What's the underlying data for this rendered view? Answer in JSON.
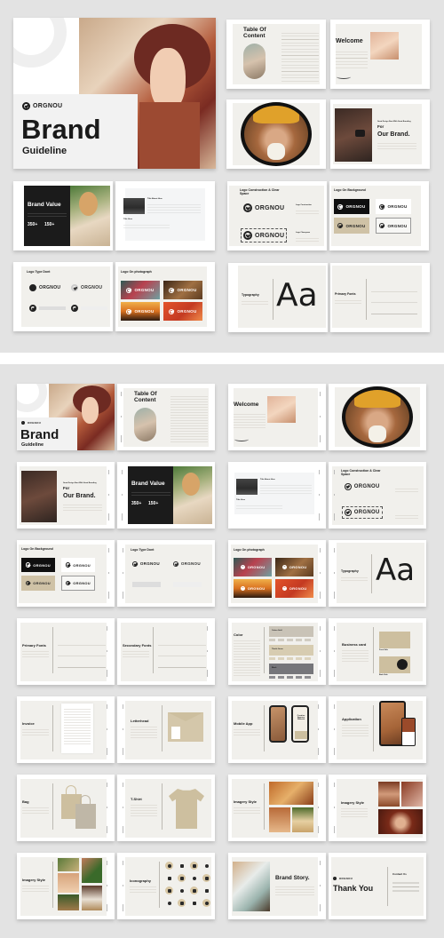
{
  "brand": {
    "name": "ORGNOU",
    "accent": "#cbbd9f",
    "dark": "#1b1b1b",
    "paper": "#f1f0ec",
    "canvas": "#e3e3e3"
  },
  "section1": {
    "cover": {
      "logo": "ORGNOU",
      "title": "Brand",
      "subtitle": "Guideline"
    },
    "toc": {
      "title": "Table Of Content"
    },
    "welcome": {
      "title": "Welcome"
    },
    "portrait": {
      "alt": "woman with yellow headband"
    },
    "our_brand": {
      "kicker": "Great Design Start With Great Branding",
      "for": "For",
      "title": "Our Brand."
    },
    "brand_value": {
      "title": "Brand Value",
      "stat1": "350+",
      "stat2": "150+"
    },
    "article": {
      "heading": "Title About Here",
      "subheading": "Title Here"
    },
    "logo_construction": {
      "title": "Logo Construction & Clear Space",
      "label1": "Logo Construction",
      "label2": "Logo Clearspace",
      "logo": "ORGNOU"
    },
    "logo_background": {
      "title": "Logo On Background",
      "logo": "ORGNOU"
    },
    "logo_type_dont": {
      "title": "Logo Type Dont",
      "logo": "ORGNOU"
    },
    "logo_photo": {
      "title": "Logo On photograph",
      "logo": "ORGNOU"
    },
    "typography": {
      "title": "Typography",
      "sample": "Aa"
    },
    "primary_fonts": {
      "title": "Primary Fonts"
    }
  },
  "section2": {
    "cover": {
      "logo": "ORGNOU",
      "title": "Brand",
      "subtitle": "Guideline"
    },
    "toc": {
      "title": "Table Of Content"
    },
    "welcome": {
      "title": "Welcome"
    },
    "our_brand": {
      "kicker": "Great Design Start With Great Branding",
      "for": "For",
      "title": "Our Brand."
    },
    "brand_value": {
      "title": "Brand Value",
      "stat1": "350+",
      "stat2": "150+"
    },
    "article": {
      "heading": "Title About Here",
      "subheading": "Title Here"
    },
    "logo_construction": {
      "title": "Logo Construction & Clear Space",
      "logo": "ORGNOU"
    },
    "logo_background": {
      "title": "Logo On Background",
      "logo": "ORGNOU"
    },
    "logo_type_dont": {
      "title": "Logo Type Dont",
      "logo": "ORGNOU"
    },
    "logo_photo": {
      "title": "Logo On photograph",
      "logo": "ORGNOU"
    },
    "typography": {
      "title": "Typography",
      "sample": "Aa"
    },
    "primary_fonts": {
      "title": "Primary Fonts"
    },
    "secondary_fonts": {
      "title": "Secondary Fonts"
    },
    "color": {
      "title": "Color",
      "swatches": [
        {
          "name": "Cotton Gold",
          "hex": "#c9c3b7"
        },
        {
          "name": "Thistle Green",
          "hex": "#d7ccb1"
        },
        {
          "name": "Black",
          "hex": "#76767a"
        }
      ]
    },
    "business_card": {
      "title": "Business card",
      "front": "Front Side",
      "back": "Back Side"
    },
    "invoice": {
      "title": "Invoice"
    },
    "letterhead": {
      "title": "Letterhead"
    },
    "mobile_app": {
      "title": "Mobile App",
      "screen_text": "Creative Agency Website"
    },
    "application": {
      "title": "Application"
    },
    "bag": {
      "title": "Bag"
    },
    "tshirt": {
      "title": "T-Shirt"
    },
    "imagery1": {
      "title": "Imagery Style"
    },
    "imagery2": {
      "title": "Imagery Style"
    },
    "imagery3": {
      "title": "Imagery Style"
    },
    "iconography": {
      "title": "Iconography"
    },
    "brand_story": {
      "title": "Brand Story."
    },
    "thank_you": {
      "logo": "ORGNOU",
      "title": "Thank You",
      "contact": "Contact Us"
    }
  }
}
